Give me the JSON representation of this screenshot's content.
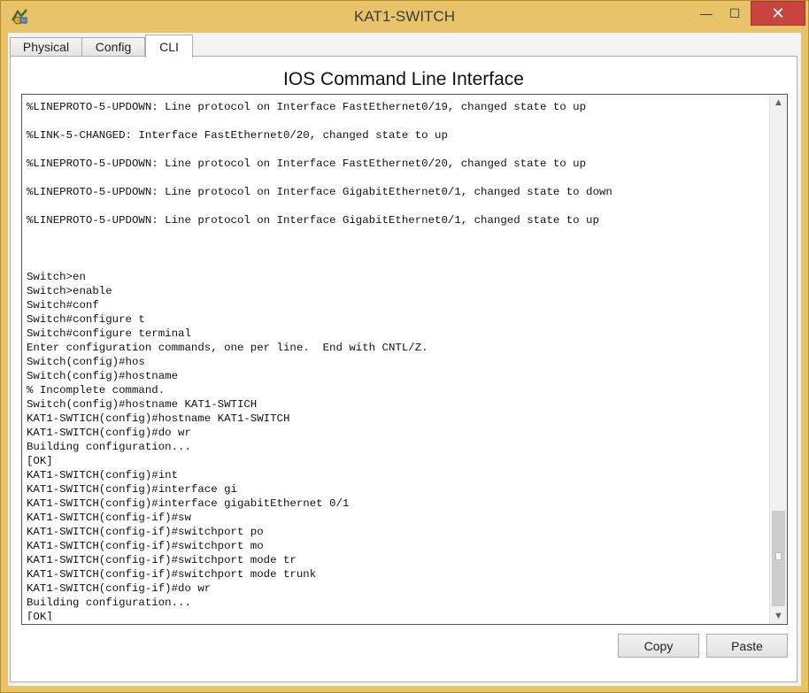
{
  "window": {
    "title": "KAT1-SWITCH",
    "minimize_glyph": "—",
    "maximize_glyph": "☐",
    "close_glyph": "✕"
  },
  "tabs": [
    {
      "label": "Physical",
      "active": false
    },
    {
      "label": "Config",
      "active": false
    },
    {
      "label": "CLI",
      "active": true
    }
  ],
  "panel": {
    "title": "IOS Command Line Interface"
  },
  "terminal": {
    "lines": [
      "%LINEPROTO-5-UPDOWN: Line protocol on Interface FastEthernet0/19, changed state to up",
      "",
      "%LINK-5-CHANGED: Interface FastEthernet0/20, changed state to up",
      "",
      "%LINEPROTO-5-UPDOWN: Line protocol on Interface FastEthernet0/20, changed state to up",
      "",
      "%LINEPROTO-5-UPDOWN: Line protocol on Interface GigabitEthernet0/1, changed state to down",
      "",
      "%LINEPROTO-5-UPDOWN: Line protocol on Interface GigabitEthernet0/1, changed state to up",
      "",
      "",
      "",
      "Switch>en",
      "Switch>enable",
      "Switch#conf",
      "Switch#configure t",
      "Switch#configure terminal",
      "Enter configuration commands, one per line.  End with CNTL/Z.",
      "Switch(config)#hos",
      "Switch(config)#hostname",
      "% Incomplete command.",
      "Switch(config)#hostname KAT1-SWTICH",
      "KAT1-SWTICH(config)#hostname KAT1-SWITCH",
      "KAT1-SWITCH(config)#do wr",
      "Building configuration...",
      "[OK]",
      "KAT1-SWITCH(config)#int",
      "KAT1-SWITCH(config)#interface gi",
      "KAT1-SWITCH(config)#interface gigabitEthernet 0/1",
      "KAT1-SWITCH(config-if)#sw",
      "KAT1-SWITCH(config-if)#switchport po",
      "KAT1-SWITCH(config-if)#switchport mo",
      "KAT1-SWITCH(config-if)#switchport mode tr",
      "KAT1-SWITCH(config-if)#switchport mode trunk",
      "KAT1-SWITCH(config-if)#do wr",
      "Building configuration...",
      "[OK]"
    ],
    "prompt": "KAT1-SWITCH(config-if)#",
    "scroll_up_glyph": "▲",
    "scroll_down_glyph": "▼"
  },
  "buttons": {
    "copy": "Copy",
    "paste": "Paste"
  },
  "colors": {
    "frame": "#e8c36a",
    "close_button": "#c7443f",
    "panel_background": "#ffffff"
  }
}
